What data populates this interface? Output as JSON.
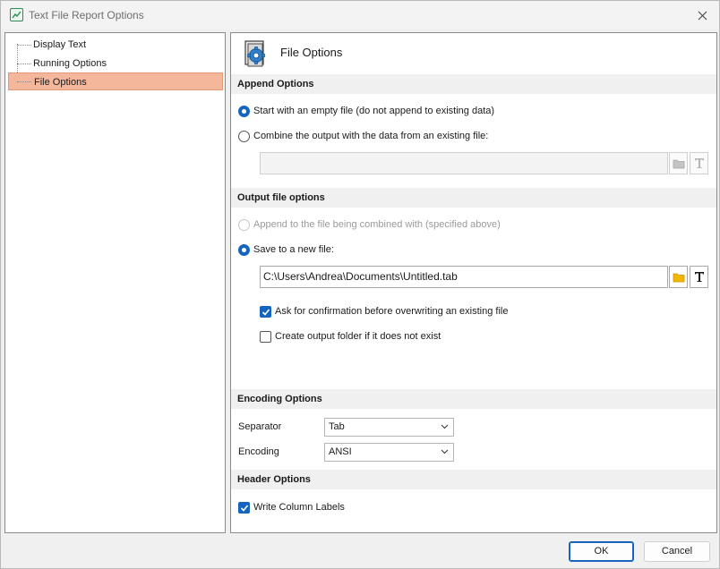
{
  "window": {
    "title": "Text File Report Options"
  },
  "tree": {
    "items": [
      {
        "label": "Display Text",
        "selected": false
      },
      {
        "label": "Running Options",
        "selected": false
      },
      {
        "label": "File Options",
        "selected": true
      }
    ]
  },
  "content": {
    "title": "File Options",
    "append_options": {
      "header": "Append Options",
      "option_empty": "Start with an empty file (do not append to existing data)",
      "option_combine": "Combine the output with the data from an existing file:",
      "selected": "empty",
      "combine_path_value": ""
    },
    "output_options": {
      "header": "Output file options",
      "option_append": "Append to the file being combined with (specified above)",
      "option_new": "Save to a new file:",
      "selected": "new",
      "path_value": "C:\\Users\\Andrea\\Documents\\Untitled.tab",
      "ask_confirm_label": "Ask for confirmation before overwriting an existing file",
      "ask_confirm_checked": true,
      "create_folder_label": "Create output folder if it does not exist",
      "create_folder_checked": false
    },
    "encoding_options": {
      "header": "Encoding Options",
      "separator_label": "Separator",
      "separator_value": "Tab",
      "encoding_label": "Encoding",
      "encoding_value": "ANSI"
    },
    "header_options": {
      "header": "Header Options",
      "write_labels_label": "Write Column Labels",
      "write_labels_checked": true
    }
  },
  "buttons": {
    "ok": "OK",
    "cancel": "Cancel"
  },
  "colors": {
    "accent": "#1565c0",
    "selection": "#f5b79c",
    "folder": "#f2b600"
  }
}
